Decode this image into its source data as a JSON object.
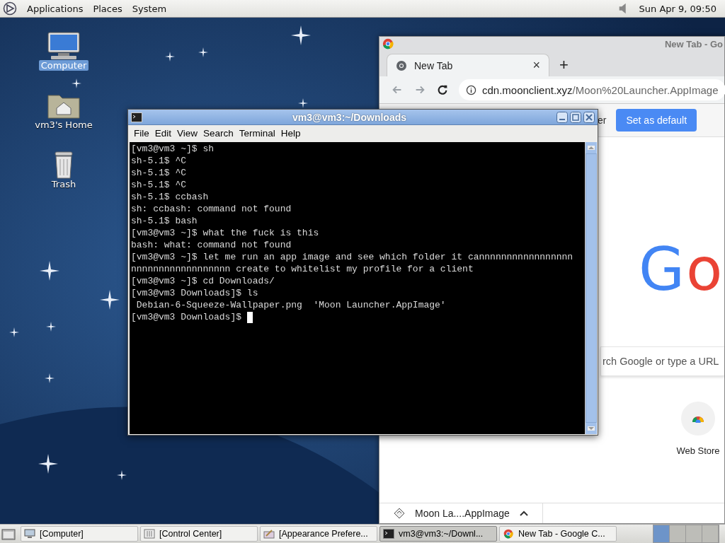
{
  "top_panel": {
    "menus": [
      "Applications",
      "Places",
      "System"
    ],
    "clock": "Sun Apr  9, 09:50"
  },
  "desktop_icons": [
    {
      "label": "Computer",
      "kind": "computer",
      "selected": true
    },
    {
      "label": "vm3's Home",
      "kind": "home",
      "selected": false
    },
    {
      "label": "Trash",
      "kind": "trash",
      "selected": false
    }
  ],
  "browser": {
    "title": "New Tab - Go",
    "tab": {
      "label": "New Tab",
      "close": "×"
    },
    "new_tab": "+",
    "address": {
      "host": "cdn.moonclient.xyz",
      "path": "/Moon%20Launcher.AppImage"
    },
    "infobar_text": "er",
    "set_default": "Set as default",
    "logo_letters": [
      {
        "text": "G",
        "color": "#4285f4"
      },
      {
        "text": "o",
        "color": "#ea4335"
      }
    ],
    "search_placeholder": "rch Google or type a URL",
    "shortcut": "Web Store",
    "download": "Moon La....AppImage"
  },
  "terminal": {
    "title": "vm3@vm3:~/Downloads",
    "menus": [
      "File",
      "Edit",
      "View",
      "Search",
      "Terminal",
      "Help"
    ],
    "lines": [
      "[vm3@vm3 ~]$ sh",
      "sh-5.1$ ^C",
      "sh-5.1$ ^C",
      "sh-5.1$ ^C",
      "sh-5.1$ ccbash",
      "sh: ccbash: command not found",
      "sh-5.1$ bash",
      "[vm3@vm3 ~]$ what the fuck is this",
      "bash: what: command not found",
      "[vm3@vm3 ~]$ let me run an app image and see which folder it cannnnnnnnnnnnnnnnn",
      "nnnnnnnnnnnnnnnnnn create to whitelist my profile for a client",
      "[vm3@vm3 ~]$ cd Downloads/",
      "[vm3@vm3 Downloads]$ ls",
      " Debian-6-Squeeze-Wallpaper.png  'Moon Launcher.AppImage'",
      "[vm3@vm3 Downloads]$ "
    ]
  },
  "taskbar": [
    {
      "label": "[Computer]",
      "kind": "computer",
      "selected": false
    },
    {
      "label": "[Control Center]",
      "kind": "control",
      "selected": false
    },
    {
      "label": "[Appearance Prefere...",
      "kind": "appearance",
      "selected": false
    },
    {
      "label": "vm3@vm3:~/Downl...",
      "kind": "terminal",
      "selected": true
    },
    {
      "label": "New Tab - Google C...",
      "kind": "chrome",
      "selected": false
    }
  ]
}
